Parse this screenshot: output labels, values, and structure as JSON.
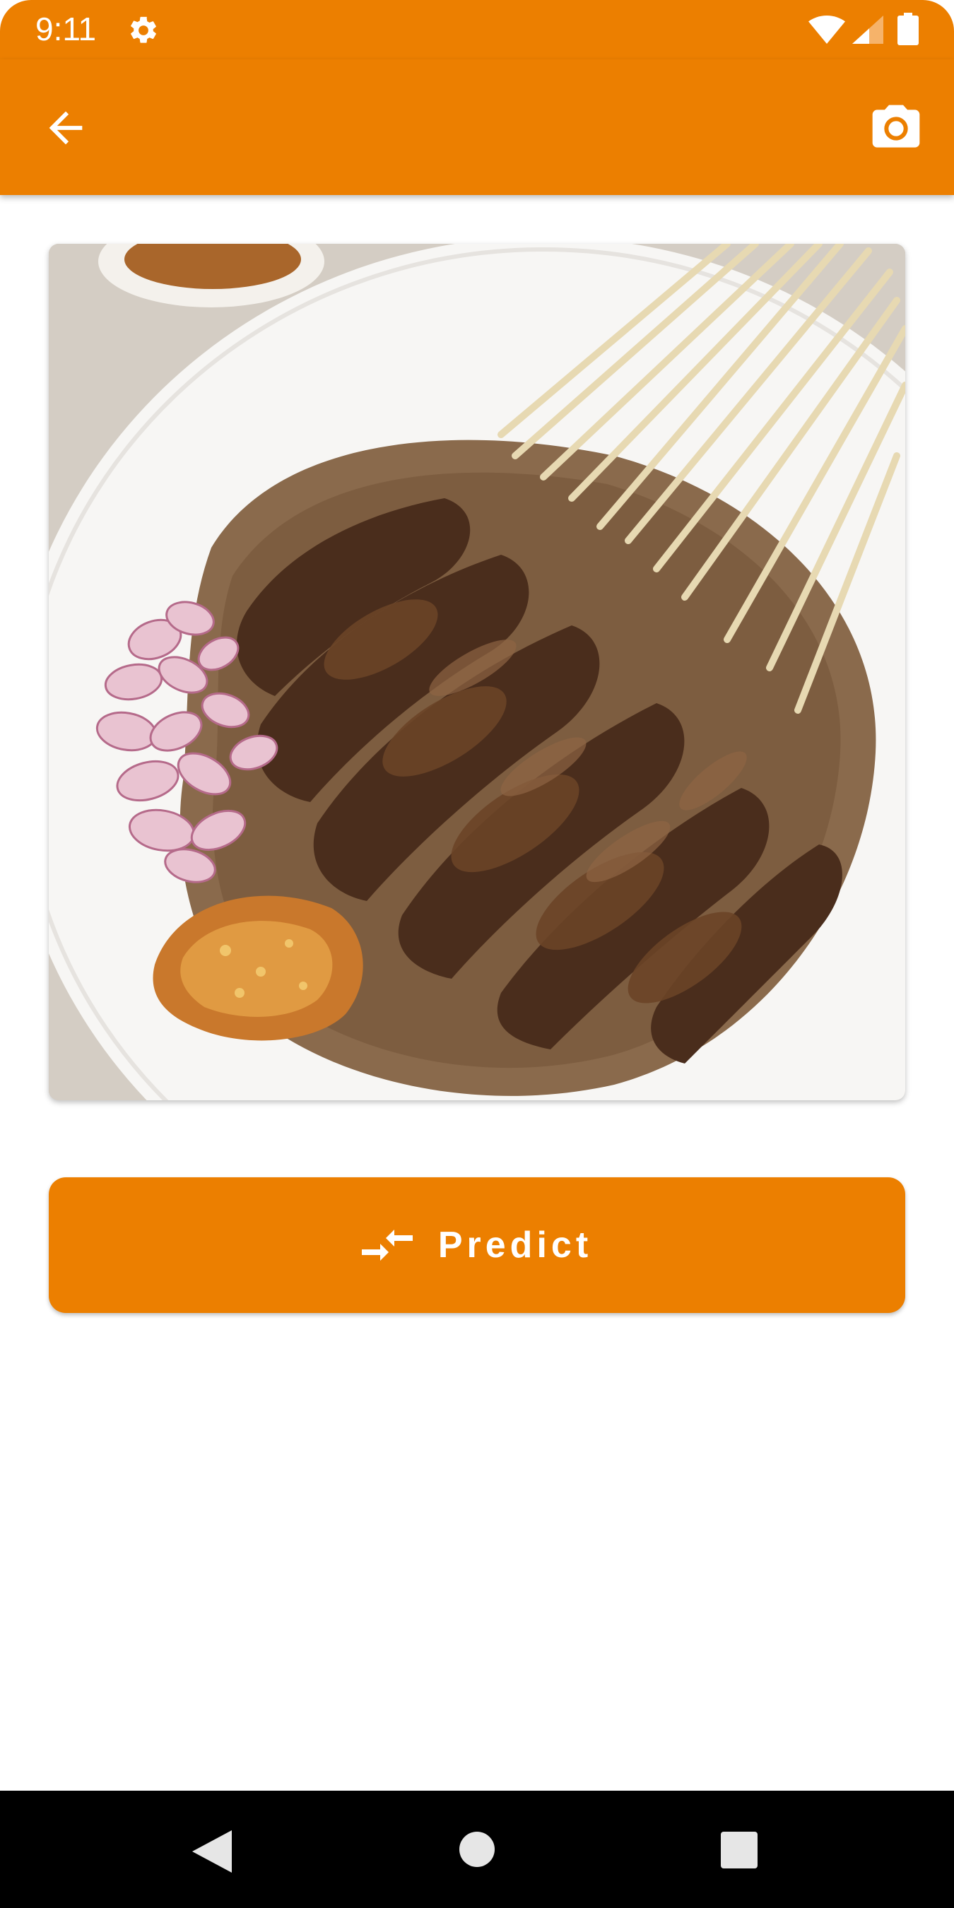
{
  "status_bar": {
    "time": "9:11",
    "icons": [
      "settings-gear-icon",
      "wifi-icon",
      "cell-signal-icon",
      "battery-icon"
    ]
  },
  "app_bar": {
    "back_icon": "arrow-back-icon",
    "camera_icon": "camera-icon"
  },
  "photo": {
    "subject": "food-photo-satay"
  },
  "predict_button": {
    "label": "Predict",
    "icon": "compare-arrows-icon"
  },
  "nav_bar": {
    "icons": [
      "nav-back-icon",
      "nav-home-icon",
      "nav-recents-icon"
    ]
  },
  "colors": {
    "primary": "#ec7f00",
    "on_primary": "#ffffff",
    "background": "#ffffff",
    "nav_bar": "#000000"
  }
}
